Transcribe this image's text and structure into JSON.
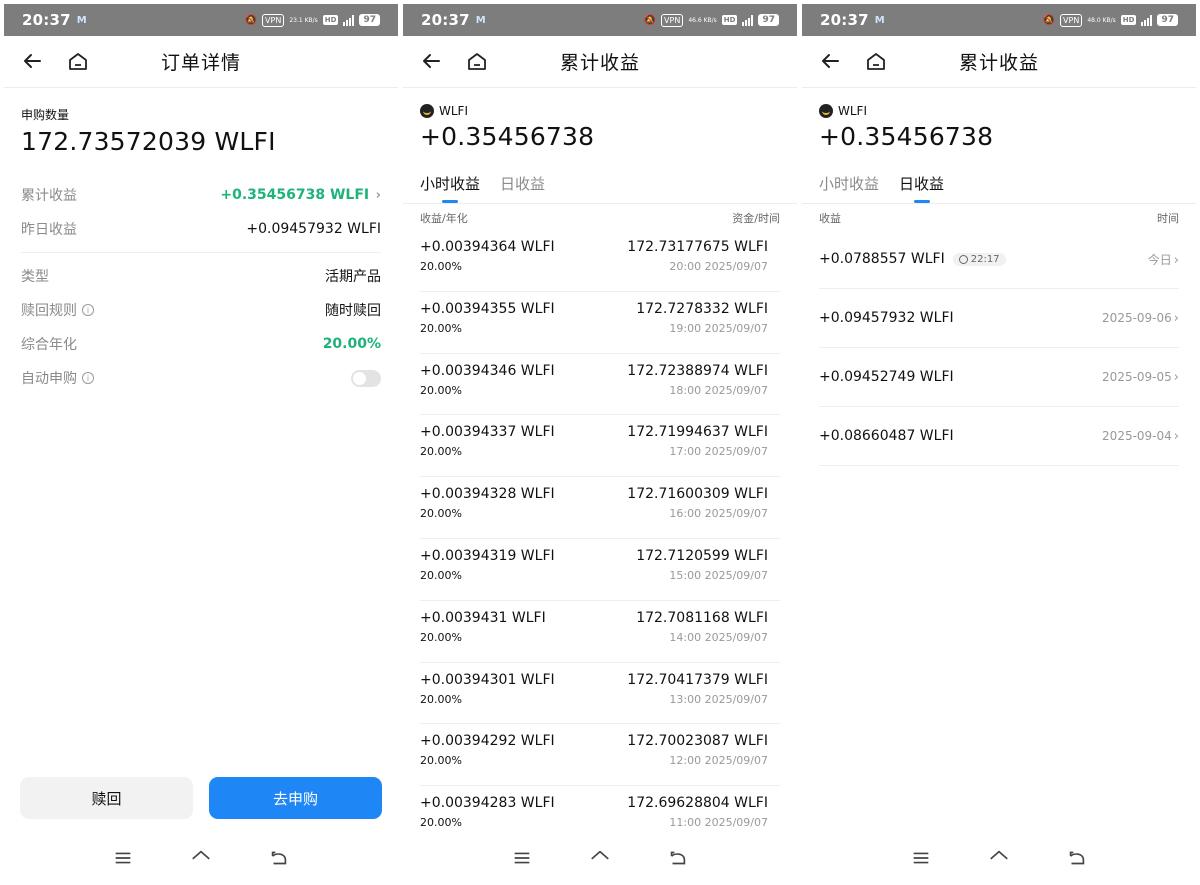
{
  "status": {
    "time": "20:37",
    "vpn": "VPN",
    "hd": "HD",
    "battery": "97",
    "speeds": [
      "23.1 KB/s",
      "46.6 KB/s",
      "48.0 KB/s"
    ]
  },
  "panel1": {
    "title": "订单详情",
    "qty_label": "申购数量",
    "qty_value": "172.73572039 WLFI",
    "cum_label": "累计收益",
    "cum_value": "+0.35456738 WLFI",
    "yest_label": "昨日收益",
    "yest_value": "+0.09457932 WLFI",
    "type_label": "类型",
    "type_value": "活期产品",
    "redeem_rule_label": "赎回规则",
    "redeem_rule_value": "随时赎回",
    "apy_label": "综合年化",
    "apy_value": "20.00%",
    "auto_label": "自动申购",
    "redeem_btn": "赎回",
    "subscribe_btn": "去申购"
  },
  "panel2": {
    "title": "累计收益",
    "coin": "WLFI",
    "total": "+0.35456738",
    "tabs": [
      "小时收益",
      "日收益"
    ],
    "col_left": "收益/年化",
    "col_right": "资金/时间",
    "rows": [
      {
        "earn": "+0.00394364 WLFI",
        "apy": "20.00%",
        "fund": "172.73177675 WLFI",
        "time": "20:00 2025/09/07"
      },
      {
        "earn": "+0.00394355 WLFI",
        "apy": "20.00%",
        "fund": "172.7278332 WLFI",
        "time": "19:00 2025/09/07"
      },
      {
        "earn": "+0.00394346 WLFI",
        "apy": "20.00%",
        "fund": "172.72388974 WLFI",
        "time": "18:00 2025/09/07"
      },
      {
        "earn": "+0.00394337 WLFI",
        "apy": "20.00%",
        "fund": "172.71994637 WLFI",
        "time": "17:00 2025/09/07"
      },
      {
        "earn": "+0.00394328 WLFI",
        "apy": "20.00%",
        "fund": "172.71600309 WLFI",
        "time": "16:00 2025/09/07"
      },
      {
        "earn": "+0.00394319 WLFI",
        "apy": "20.00%",
        "fund": "172.7120599 WLFI",
        "time": "15:00 2025/09/07"
      },
      {
        "earn": "+0.0039431 WLFI",
        "apy": "20.00%",
        "fund": "172.7081168 WLFI",
        "time": "14:00 2025/09/07"
      },
      {
        "earn": "+0.00394301 WLFI",
        "apy": "20.00%",
        "fund": "172.70417379 WLFI",
        "time": "13:00 2025/09/07"
      },
      {
        "earn": "+0.00394292 WLFI",
        "apy": "20.00%",
        "fund": "172.70023087 WLFI",
        "time": "12:00 2025/09/07"
      },
      {
        "earn": "+0.00394283 WLFI",
        "apy": "20.00%",
        "fund": "172.69628804 WLFI",
        "time": "11:00 2025/09/07"
      }
    ]
  },
  "panel3": {
    "title": "累计收益",
    "coin": "WLFI",
    "total": "+0.35456738",
    "tabs": [
      "小时收益",
      "日收益"
    ],
    "col_left": "收益",
    "col_right": "时间",
    "rows": [
      {
        "earn": "+0.0788557 WLFI",
        "badge": "22:17",
        "date": "今日"
      },
      {
        "earn": "+0.09457932 WLFI",
        "date": "2025-09-06"
      },
      {
        "earn": "+0.09452749 WLFI",
        "date": "2025-09-05"
      },
      {
        "earn": "+0.08660487 WLFI",
        "date": "2025-09-04"
      }
    ]
  }
}
